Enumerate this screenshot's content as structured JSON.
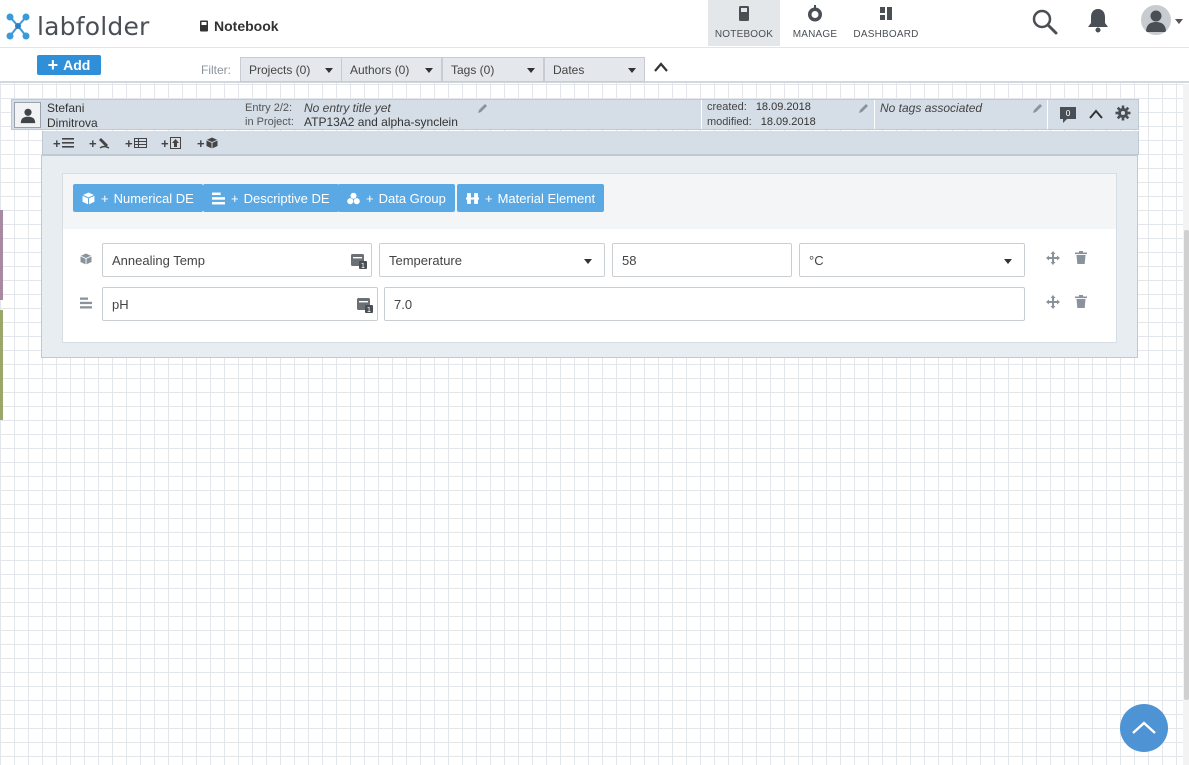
{
  "app": {
    "name": "labfolder"
  },
  "header": {
    "page_title": "Notebook",
    "nav": [
      {
        "label": "NOTEBOOK",
        "active": true
      },
      {
        "label": "MANAGE",
        "active": false
      },
      {
        "label": "DASHBOARD",
        "active": false
      }
    ]
  },
  "toolbar": {
    "add_label": "Add",
    "filter_label": "Filter:",
    "filters": [
      {
        "label": "Projects (0)"
      },
      {
        "label": "Authors (0)"
      },
      {
        "label": "Tags (0)"
      },
      {
        "label": "Dates"
      }
    ]
  },
  "entry": {
    "author_first": "Stefani",
    "author_last": "Dimitrova",
    "entry_label": "Entry 2/2:",
    "project_label": "in Project:",
    "title": "No entry title yet",
    "project": "ATP13A2 and alpha-synclein",
    "created_label": "created:",
    "created": "18.09.2018",
    "modified_label": "modified:",
    "modified": "18.09.2018",
    "tags": "No tags associated",
    "comment_count": "0"
  },
  "data_elements": {
    "buttons": [
      {
        "label": "Numerical DE"
      },
      {
        "label": "Descriptive DE"
      },
      {
        "label": "Data Group"
      },
      {
        "label": "Material Element"
      }
    ],
    "numerical": {
      "name": "Annealing Temp",
      "quantity": "Temperature",
      "value": "58",
      "unit": "°C"
    },
    "descriptive": {
      "name": "pH",
      "value": "7.0"
    }
  },
  "colors": {
    "primary": "#2f8fd8",
    "de_button": "#5aa9e4",
    "entry_header": "#d5dde6",
    "scroll_top": "#4e93d3"
  }
}
